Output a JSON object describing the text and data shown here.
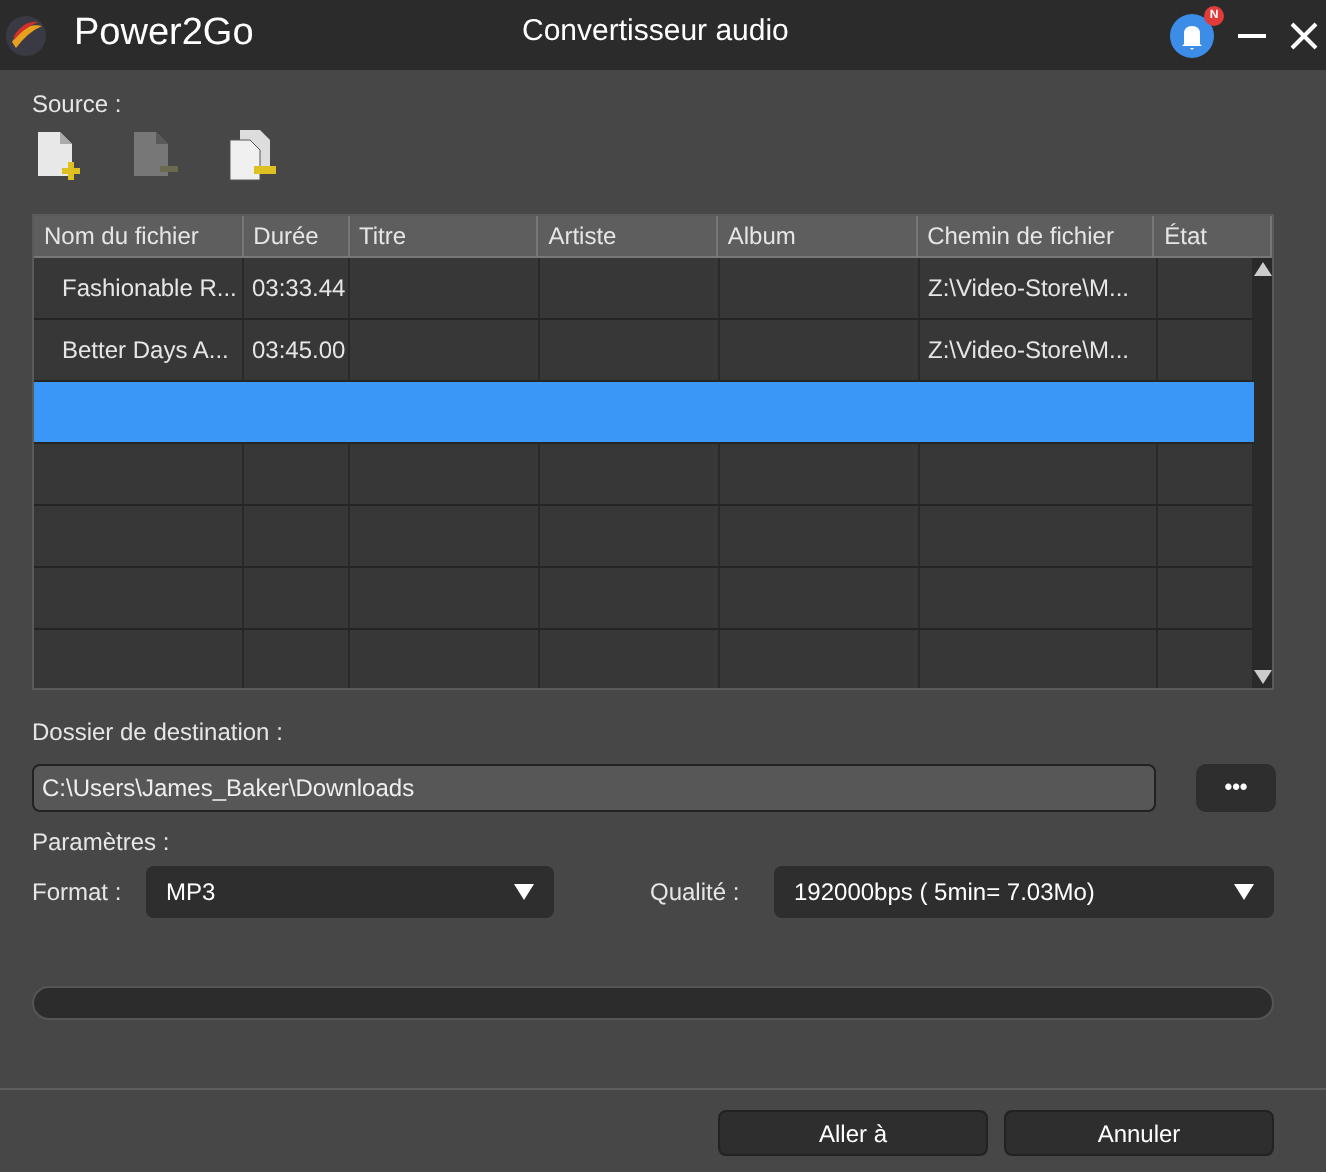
{
  "window": {
    "app_name": "Power2Go",
    "title": "Convertisseur audio",
    "notification_badge": "N"
  },
  "source": {
    "label": "Source :"
  },
  "table": {
    "columns": [
      "Nom du fichier",
      "Durée",
      "Titre",
      "Artiste",
      "Album",
      "Chemin de fichier",
      "État"
    ],
    "rows": [
      {
        "cells": [
          "Fashionable R...",
          "03:33.44",
          "",
          "",
          "",
          "Z:\\Video-Store\\M...",
          ""
        ],
        "selected": false
      },
      {
        "cells": [
          "Better Days A...",
          "03:45.00",
          "",
          "",
          "",
          "Z:\\Video-Store\\M...",
          ""
        ],
        "selected": false
      },
      {
        "selected": true
      }
    ]
  },
  "destination": {
    "label": "Dossier de destination :",
    "value": "C:\\Users\\James_Baker\\Downloads",
    "browse": "•••"
  },
  "settings": {
    "label": "Paramètres :",
    "format_label": "Format :",
    "format": "MP3",
    "quality_label": "Qualité :",
    "quality": "192000bps ( 5min= 7.03Mo)"
  },
  "progress": {
    "level": 0
  },
  "buttons": [
    "Aller à",
    "Annuler"
  ]
}
